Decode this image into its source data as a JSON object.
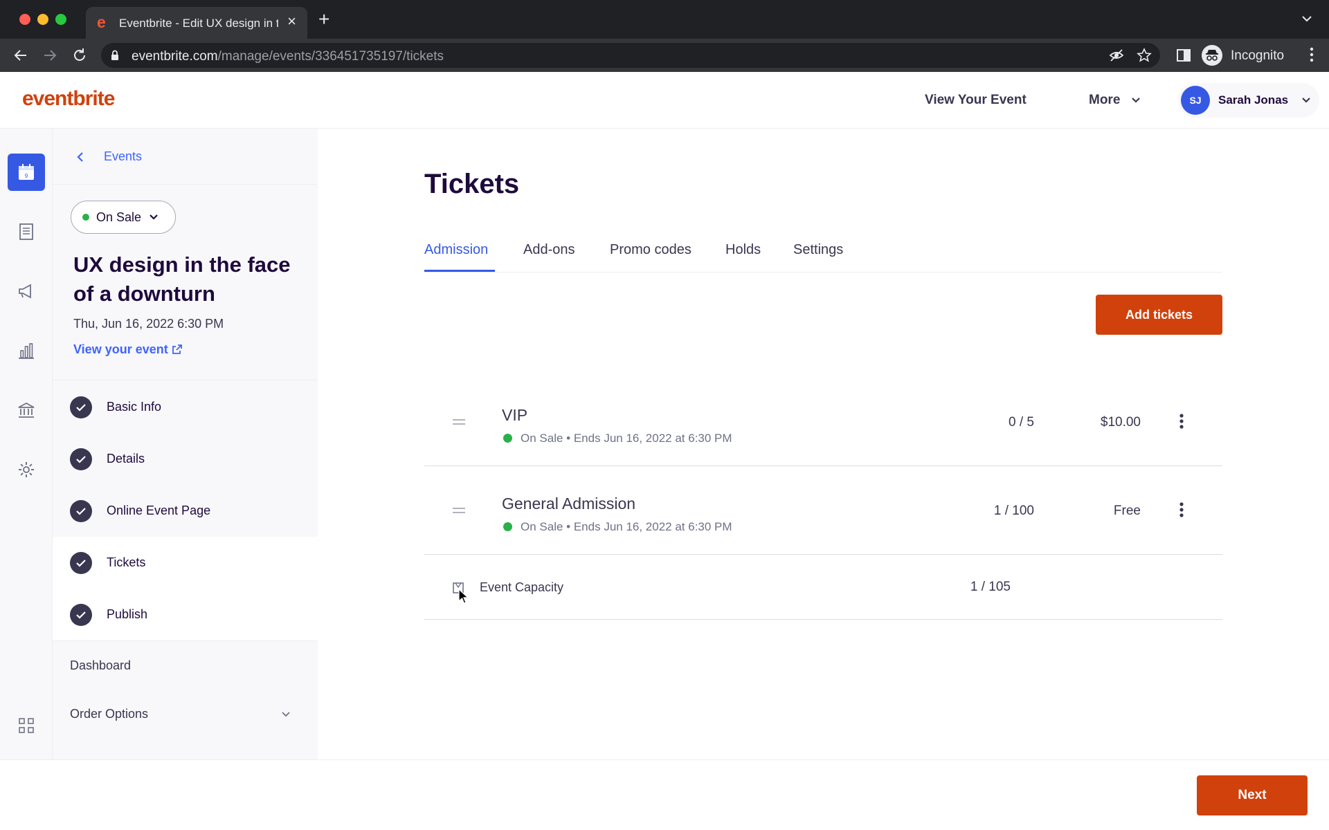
{
  "browser": {
    "tab_favicon": "e",
    "tab_title": "Eventbrite - Edit UX design in t",
    "url_domain": "eventbrite.com",
    "url_path": "/manage/events/336451735197/tickets",
    "profile_label": "Incognito"
  },
  "header": {
    "logo": "eventbrite",
    "view_your_event": "View Your Event",
    "more": "More",
    "user_initials": "SJ",
    "user_name": "Sarah Jonas"
  },
  "sidenav": {
    "back_label": "Events",
    "status": "On Sale",
    "event_title": "UX design in the face of a downturn",
    "event_date": "Thu, Jun 16, 2022 6:30 PM",
    "view_event": "View your event",
    "steps": [
      {
        "label": "Basic Info"
      },
      {
        "label": "Details"
      },
      {
        "label": "Online Event Page"
      },
      {
        "label": "Tickets"
      },
      {
        "label": "Publish"
      }
    ],
    "dashboard": "Dashboard",
    "order_options": "Order Options"
  },
  "main": {
    "title": "Tickets",
    "tabs": [
      "Admission",
      "Add-ons",
      "Promo codes",
      "Holds",
      "Settings"
    ],
    "add_tickets": "Add tickets",
    "tickets": [
      {
        "name": "VIP",
        "status": "On Sale",
        "ends": "Ends Jun 16, 2022 at 6:30 PM",
        "sold": "0 / 5",
        "price": "$10.00"
      },
      {
        "name": "General Admission",
        "status": "On Sale",
        "ends": "Ends Jun 16, 2022 at 6:30 PM",
        "sold": "1 / 100",
        "price": "Free"
      }
    ],
    "capacity_label": "Event Capacity",
    "capacity_value": "1 / 105"
  },
  "footer": {
    "next": "Next"
  },
  "colors": {
    "brand": "#d1410c",
    "accent": "#3659e3",
    "link": "#3d64ff",
    "status_green": "#2ab04b"
  }
}
